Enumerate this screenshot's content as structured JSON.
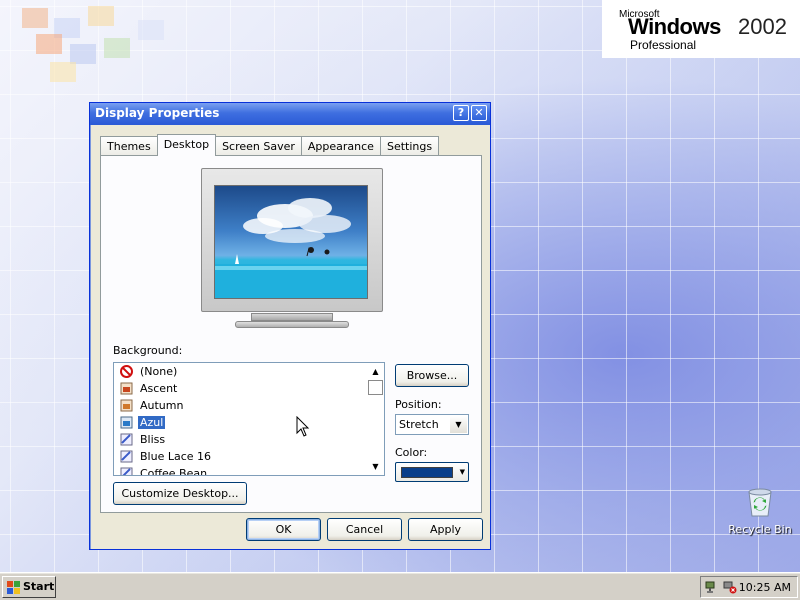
{
  "branding": {
    "microsoft": "Microsoft",
    "windows": "Windows",
    "year": "2002",
    "edition": "Professional"
  },
  "desktop": {
    "recycle_bin": "Recycle Bin"
  },
  "dialog": {
    "title": "Display Properties",
    "help_label": "?",
    "close_label": "✕",
    "tabs": [
      "Themes",
      "Desktop",
      "Screen Saver",
      "Appearance",
      "Settings"
    ],
    "active_tab": "Desktop",
    "background_label": "Background:",
    "backgrounds": [
      {
        "label": "(None)",
        "icon": "none-icon"
      },
      {
        "label": "Ascent",
        "icon": "image-file-icon"
      },
      {
        "label": "Autumn",
        "icon": "image-file-icon"
      },
      {
        "label": "Azul",
        "icon": "image-file-icon",
        "selected": true
      },
      {
        "label": "Bliss",
        "icon": "bitmap-file-icon"
      },
      {
        "label": "Blue Lace 16",
        "icon": "bitmap-file-icon"
      },
      {
        "label": "Coffee Bean",
        "icon": "bitmap-file-icon"
      }
    ],
    "browse_button": "Browse...",
    "position_label": "Position:",
    "position_value": "Stretch",
    "color_label": "Color:",
    "color_value": "#0a3f8a",
    "customize_button": "Customize Desktop...",
    "ok_button": "OK",
    "cancel_button": "Cancel",
    "apply_button": "Apply"
  },
  "taskbar": {
    "start_label": "Start",
    "clock": "10:25 AM"
  }
}
